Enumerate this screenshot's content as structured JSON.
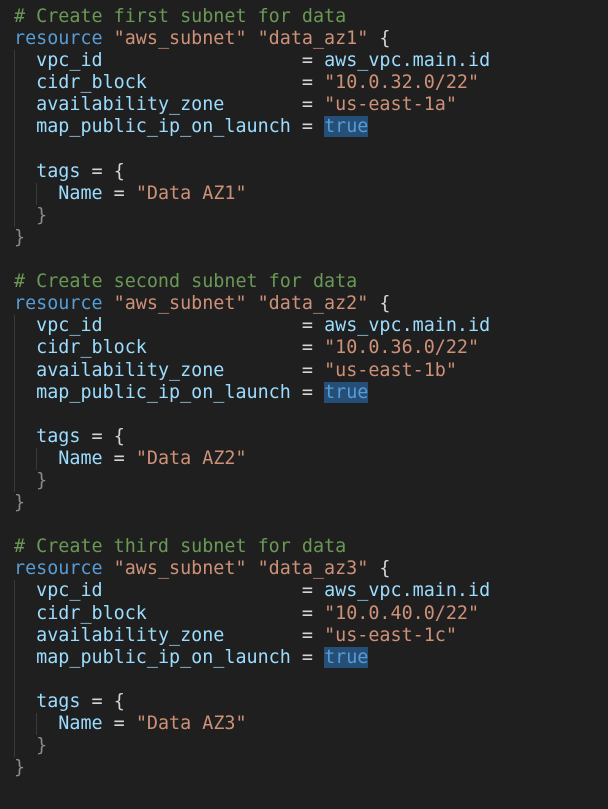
{
  "editor": {
    "blocks": [
      {
        "comment": "# Create first subnet for data",
        "keyword": "resource",
        "type": "\"aws_subnet\"",
        "name": "\"data_az1\"",
        "open": "{",
        "vpc_key": "vpc_id",
        "vpc_pad": "                 ",
        "vpc_val": "aws_vpc.main.id",
        "cidr_key": "cidr_block",
        "cidr_pad": "             ",
        "cidr_val": "\"10.0.32.0/22\"",
        "az_key": "availability_zone",
        "az_pad": "      ",
        "az_val": "\"us-east-1a\"",
        "map_key": "map_public_ip_on_launch",
        "map_val": "true",
        "tags_key": "tags",
        "tags_open": "{",
        "tag_name_key": "Name",
        "tag_name_val": "\"Data AZ1\"",
        "inner_close": "}",
        "outer_close": "}"
      },
      {
        "comment": "# Create second subnet for data",
        "keyword": "resource",
        "type": "\"aws_subnet\"",
        "name": "\"data_az2\"",
        "open": "{",
        "vpc_key": "vpc_id",
        "vpc_pad": "                 ",
        "vpc_val": "aws_vpc.main.id",
        "cidr_key": "cidr_block",
        "cidr_pad": "             ",
        "cidr_val": "\"10.0.36.0/22\"",
        "az_key": "availability_zone",
        "az_pad": "      ",
        "az_val": "\"us-east-1b\"",
        "map_key": "map_public_ip_on_launch",
        "map_val": "true",
        "tags_key": "tags",
        "tags_open": "{",
        "tag_name_key": "Name",
        "tag_name_val": "\"Data AZ2\"",
        "inner_close": "}",
        "outer_close": "}"
      },
      {
        "comment": "# Create third subnet for data",
        "keyword": "resource",
        "type": "\"aws_subnet\"",
        "name": "\"data_az3\"",
        "open": "{",
        "vpc_key": "vpc_id",
        "vpc_pad": "                 ",
        "vpc_val": "aws_vpc.main.id",
        "cidr_key": "cidr_block",
        "cidr_pad": "             ",
        "cidr_val": "\"10.0.40.0/22\"",
        "az_key": "availability_zone",
        "az_pad": "      ",
        "az_val": "\"us-east-1c\"",
        "map_key": "map_public_ip_on_launch",
        "map_val": "true",
        "tags_key": "tags",
        "tags_open": "{",
        "tag_name_key": "Name",
        "tag_name_val": "\"Data AZ3\"",
        "inner_close": "}",
        "outer_close": "}"
      }
    ],
    "colors": {
      "background": "#1f1f1f",
      "comment": "#6a9955",
      "keyword": "#569cd6",
      "string": "#ce9178",
      "property": "#9cdcfe",
      "selection": "#264f78"
    }
  }
}
